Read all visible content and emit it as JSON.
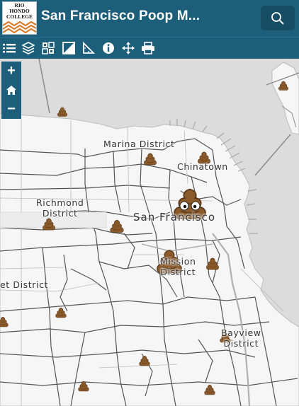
{
  "app": {
    "title": "San Francisco Poop M...",
    "logo_lines": [
      "RIO",
      "HONDO",
      "COLLEGE"
    ]
  },
  "toolbar": {
    "icons": [
      "legend-list-icon",
      "layers-icon",
      "basemap-gallery-icon",
      "print-area-icon",
      "measure-icon",
      "info-icon",
      "move-icon",
      "print-icon"
    ]
  },
  "zoom": {
    "in_label": "+",
    "home_icon": "home-icon",
    "out_label": "−"
  },
  "map": {
    "labels": {
      "marina": "Marina District",
      "chinatown": "Chinatown",
      "richmond_line1": "Richmond",
      "richmond_line2": "District",
      "city": "San Francisco",
      "mission_line1": "Mission",
      "mission_line2": "District",
      "sunset": "et District",
      "bayview_line1": "Bayview",
      "bayview_line2": "District"
    },
    "marker_icon": "poop-emoji-icon"
  },
  "colors": {
    "header": "#1d5f7a",
    "land": "#f6f6f6",
    "water": "#dcdcdc",
    "boundary": "#555555",
    "marker": "#8b5a2b"
  }
}
